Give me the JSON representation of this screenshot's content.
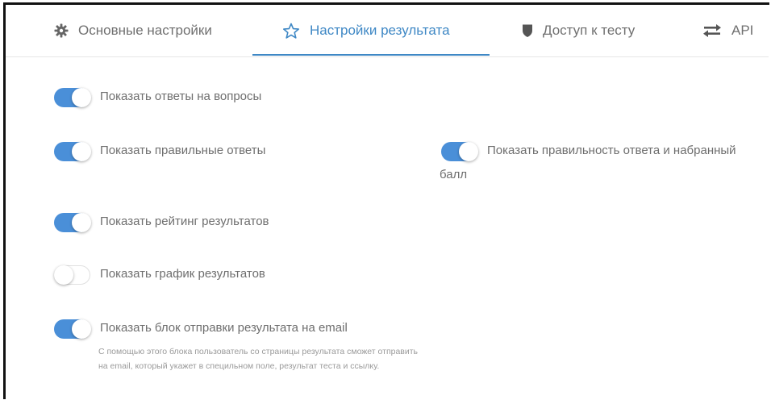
{
  "tabs": [
    {
      "label": "Основные настройки",
      "icon": "gear-icon",
      "active": false
    },
    {
      "label": "Настройки результата",
      "icon": "star-icon",
      "active": true
    },
    {
      "label": "Доступ к тесту",
      "icon": "shield-icon",
      "active": false
    },
    {
      "label": "API",
      "icon": "arrows-exchange-icon",
      "active": false
    }
  ],
  "settings": {
    "show_answers": {
      "label": "Показать ответы на вопросы",
      "enabled": true
    },
    "show_correct_answers": {
      "label": "Показать правильные ответы",
      "enabled": true
    },
    "show_correctness_score": {
      "label": "Показать правильность ответа и набранный",
      "label_tail": "балл",
      "enabled": true
    },
    "show_rating": {
      "label": "Показать рейтинг результатов",
      "enabled": true
    },
    "show_chart": {
      "label": "Показать график результатов",
      "enabled": false
    },
    "show_email_block": {
      "label": "Показать блок отправки результата на email",
      "enabled": true,
      "help": "С помощью этого блока пользователь со страницы результата сможет отправить на email, который укажет в специльном поле, результат теста и ссылку."
    }
  },
  "colors": {
    "accent": "#3f88c5",
    "switch_on": "#4a8fd8"
  }
}
